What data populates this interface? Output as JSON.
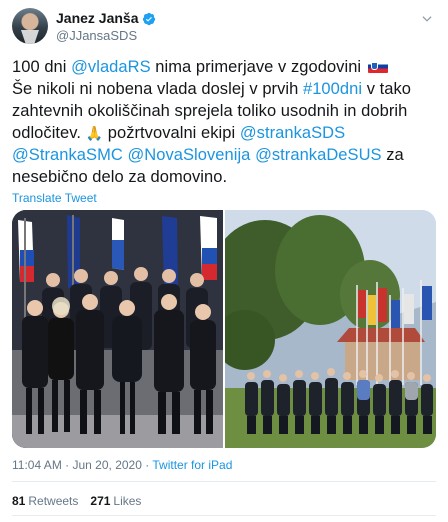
{
  "header": {
    "display_name": "Janez Janša",
    "handle": "@JJansaSDS",
    "avatar_icon": "user-avatar-icon",
    "verified_icon": "verified-badge-icon",
    "menu_icon": "chevron-down-icon"
  },
  "tweet": {
    "line1_a": "100 dni ",
    "line1_link": "@vladaRS",
    "line1_b": " nima primerjave v zgodovini",
    "line2_a": "Še nikoli ni nobena vlada doslej v prvih ",
    "line2_link": "#100dni",
    "line2_b": " v tako",
    "line3": "zahtevnih okoliščinah sprejela toliko usodnih in dobrih",
    "line4_a": "odločitev. ",
    "line4_b": " požrtvovalni ekipi ",
    "line4_link": "@strankaSDS",
    "line5_link1": "@StrankaSMC",
    "line5_link2": "@NovaSlovenija",
    "line5_link3": "@strankaDeSUS",
    "line5_b": " za",
    "line6": "nesebično delo za domovino."
  },
  "translate_label": "Translate Tweet",
  "meta": {
    "time": "11:04 AM",
    "date": "Jun 20, 2020",
    "source": "Twitter for iPad"
  },
  "stats": {
    "retweets_count": "81",
    "retweets_label": "Retweets",
    "likes_count": "271",
    "likes_label": "Likes"
  },
  "colors": {
    "link": "#1b95e0",
    "muted": "#657786",
    "text": "#14171a"
  }
}
